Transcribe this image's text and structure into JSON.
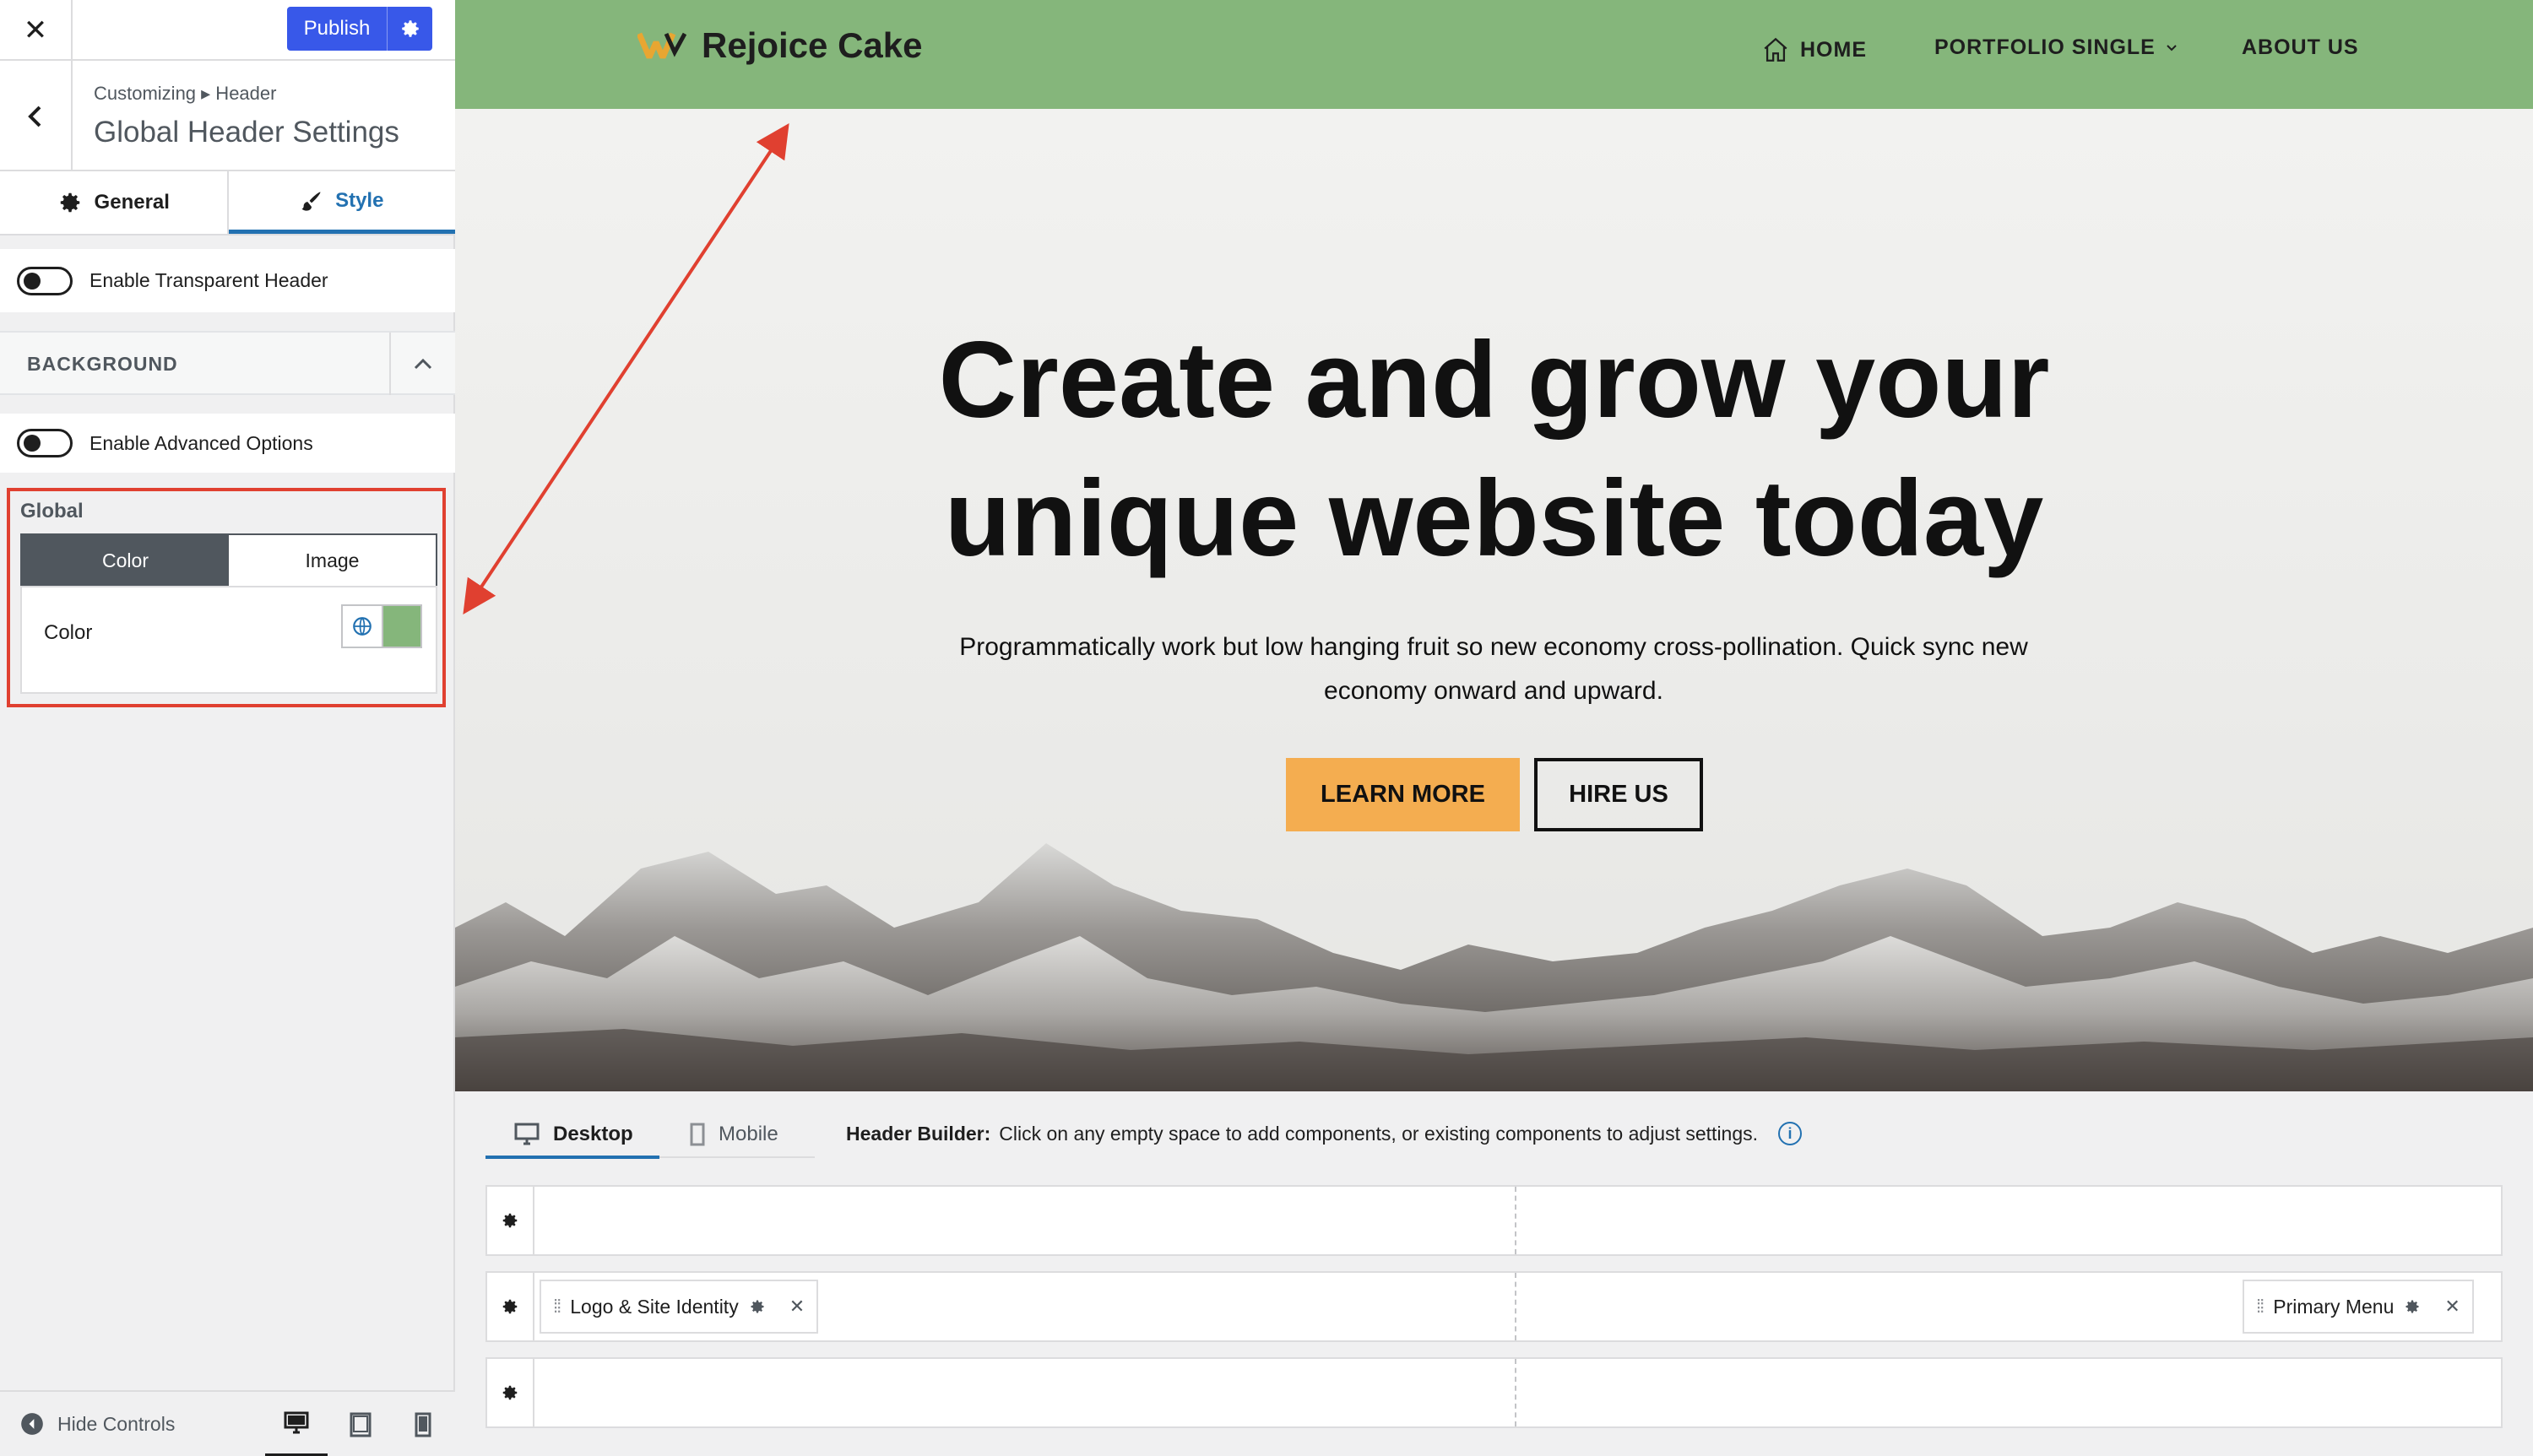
{
  "sidebar": {
    "publish_label": "Publish",
    "breadcrumb": "Customizing ▸ Header",
    "title": "Global Header Settings",
    "tabs": [
      {
        "label": "General"
      },
      {
        "label": "Style"
      }
    ],
    "transparent_header_label": "Enable Transparent Header",
    "background_section_label": "BACKGROUND",
    "advanced_options_label": "Enable Advanced Options",
    "global_label": "Global",
    "segments": [
      "Color",
      "Image"
    ],
    "color_label": "Color",
    "color_value": "#85b67b",
    "hide_controls_label": "Hide Controls"
  },
  "site": {
    "name": "Rejoice Cake",
    "nav": [
      "HOME",
      "PORTFOLIO SINGLE",
      "ABOUT US"
    ],
    "header_bg": "#85b67b",
    "hero_title_line1": "Create and grow your",
    "hero_title_line2": "unique website today",
    "hero_subtitle": "Programmatically work but low hanging fruit so new economy cross-pollination. Quick sync new economy onward and upward.",
    "btn_primary": "LEARN MORE",
    "btn_secondary": "HIRE US",
    "accent": "#f4ad50"
  },
  "builder": {
    "tabs": [
      "Desktop",
      "Mobile"
    ],
    "hint_label": "Header Builder:",
    "hint_text": "Click on any empty space to add components, or existing components to adjust settings.",
    "components": {
      "logo": "Logo & Site Identity",
      "menu": "Primary Menu"
    }
  }
}
